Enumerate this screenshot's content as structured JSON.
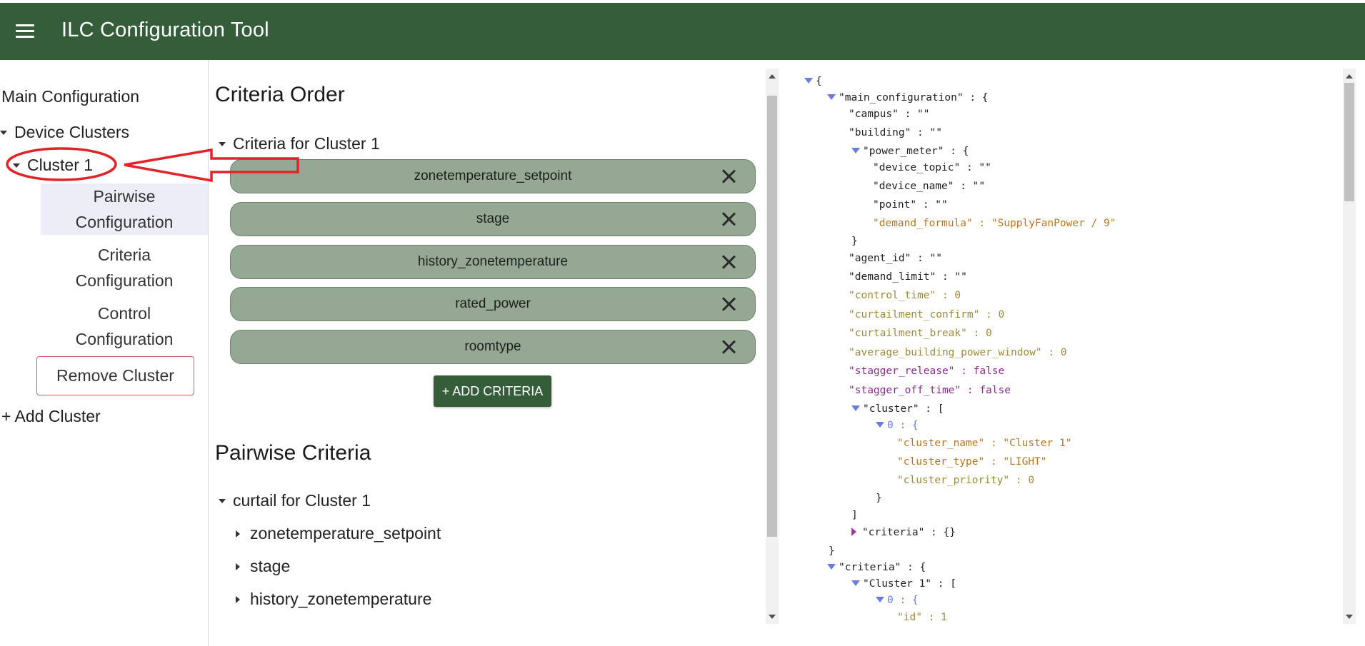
{
  "app": {
    "title": "ILC Configuration Tool",
    "menu_icon": "hamburger-menu-icon",
    "bar_color": "#355d3a"
  },
  "sidebar": {
    "main_configuration": "Main Configuration",
    "device_clusters": "Device Clusters",
    "cluster": "Cluster 1",
    "sub_items": [
      {
        "line1": "Pairwise",
        "line2": "Configuration",
        "active": true
      },
      {
        "line1": "Criteria",
        "line2": "Configuration",
        "active": false
      },
      {
        "line1": "Control",
        "line2": "Configuration",
        "active": false
      }
    ],
    "remove_cluster": "Remove Cluster",
    "add_cluster": "+ Add Cluster"
  },
  "criteria_order": {
    "heading": "Criteria Order",
    "group_label": "Criteria for Cluster 1",
    "chips": [
      "zonetemperature_setpoint",
      "stage",
      "history_zonetemperature",
      "rated_power",
      "roomtype"
    ],
    "add_button": "+ ADD CRITERIA"
  },
  "pairwise": {
    "heading": "Pairwise Criteria",
    "group_label": "curtail for Cluster 1",
    "items": [
      "zonetemperature_setpoint",
      "stage",
      "history_zonetemperature"
    ]
  },
  "json_view": {
    "lines": [
      "{",
      "\"main_configuration\" : {",
      "\"campus\" : \"\"",
      "\"building\" : \"\"",
      "\"power_meter\" : {",
      "\"device_topic\" : \"\"",
      "\"device_name\" : \"\"",
      "\"point\" : \"\"",
      "\"demand_formula\" : \"SupplyFanPower / 9\"",
      "}",
      "\"agent_id\" : \"\"",
      "\"demand_limit\" : \"\"",
      "\"control_time\" : 0",
      "\"curtailment_confirm\" : 0",
      "\"curtailment_break\" : 0",
      "\"average_building_power_window\" : 0",
      "\"stagger_release\" : false",
      "\"stagger_off_time\" : false",
      "\"cluster\" : [",
      "0 : {",
      "\"cluster_name\" : \"Cluster 1\"",
      "\"cluster_type\" : \"LIGHT\"",
      "\"cluster_priority\" : 0",
      "}",
      "]",
      "\"criteria\" : {}",
      "}",
      "\"criteria\" : {",
      "\"Cluster 1\" : [",
      "0 : {",
      "\"id\" : 1"
    ]
  },
  "colors": {
    "chip": "#94a894",
    "remove_border": "#d65a5a",
    "annotation": "#e0252a"
  }
}
